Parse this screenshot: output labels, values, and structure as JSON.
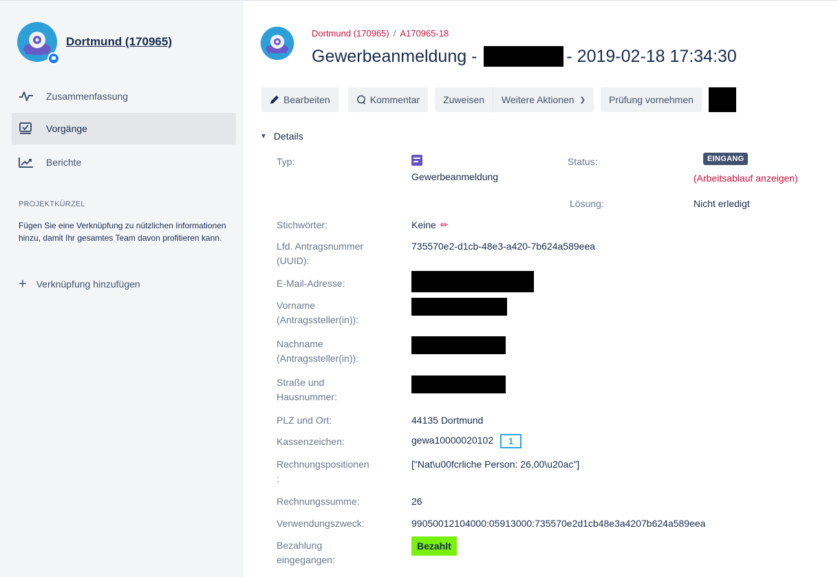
{
  "project": {
    "name": "Dortmund (170965)"
  },
  "sidebar": {
    "nav": [
      {
        "label": "Zusammenfassung",
        "icon": "activity-icon"
      },
      {
        "label": "Vorgänge",
        "icon": "issues-icon",
        "active": true
      },
      {
        "label": "Berichte",
        "icon": "reports-icon"
      }
    ],
    "shortcuts_title": "PROJEKTKÜRZEL",
    "shortcuts_text": "Fügen Sie eine Verknüpfung zu nützlichen Informationen hinzu, damit Ihr gesamtes Team davon profitieren kann.",
    "add_shortcut": "Verknüpfung hinzufügen"
  },
  "breadcrumb": {
    "project": "Dortmund (170965)",
    "issue_key": "A170965-18"
  },
  "issue": {
    "title_prefix": "Gewerbeanmeldung -",
    "title_suffix": "- 2019-02-18 17:34:30"
  },
  "toolbar": {
    "edit": "Bearbeiten",
    "comment": "Kommentar",
    "assign": "Zuweisen",
    "more": "Weitere Aktionen",
    "review": "Prüfung vornehmen"
  },
  "details": {
    "heading": "Details",
    "type_label": "Typ:",
    "type_value": "Gewerbeanmeldung",
    "status_label": "Status:",
    "status_value": "EINGANG",
    "workflow_link": "(Arbeitsablauf anzeigen)",
    "resolution_label": "Lösung:",
    "resolution_value": "Nicht erledigt",
    "fields": {
      "keywords_label": "Stichwörter:",
      "keywords_value": "Keine",
      "uuid_label_1": "Lfd. Antragsnummer",
      "uuid_label_2": "(UUID):",
      "uuid_value": "735570e2-d1cb-48e3-a420-7b624a589eea",
      "email_label": "E-Mail-Adresse:",
      "firstname_label_1": "Vorname",
      "firstname_label_2": "(Antragssteller(in)):",
      "lastname_label_1": "Nachname",
      "lastname_label_2": "(Antragssteller(in)):",
      "street_label_1": "Straße und",
      "street_label_2": "Hausnummer:",
      "city_label": "PLZ und Ort:",
      "city_value": "44135 Dortmund",
      "cashref_label": "Kassenzeichen:",
      "cashref_value": "gewa10000020102",
      "cashref_badge": "1",
      "items_label_1": "Rechnungspositionen",
      "items_label_2": ":",
      "items_value": "[\"Nat\\u00fcrliche Person: 26,00\\u20ac\"]",
      "sum_label": "Rechnungssumme:",
      "sum_value": "26",
      "purpose_label": "Verwendungszweck:",
      "purpose_value": "99050012104000:05913000:735570e2d1cb48e3a4207b624a589eea",
      "paid_label_1": "Bezahlung",
      "paid_label_2": "eingegangen:",
      "paid_value": "Bezahlt"
    }
  },
  "colors": {
    "sidebar_bg": "#f4f5f7",
    "link_red": "#d0103a",
    "paid_green": "#79f10c",
    "status_bg": "#42526e"
  }
}
